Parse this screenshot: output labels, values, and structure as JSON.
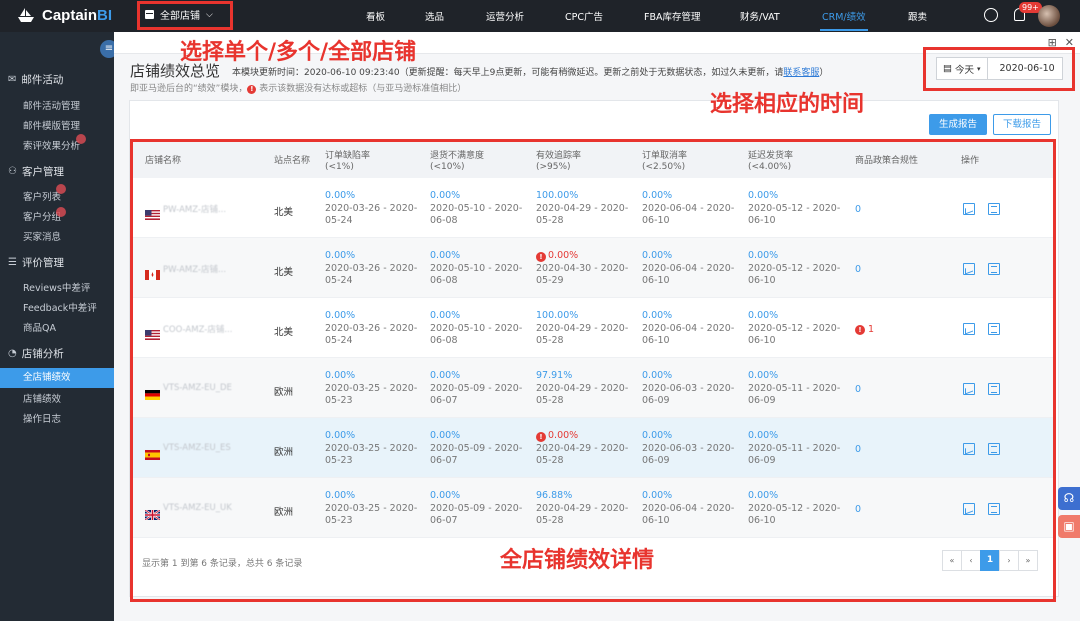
{
  "app": {
    "logo_a": "Captain",
    "logo_b": "BI",
    "shop_selector": "全部店铺"
  },
  "nav": [
    {
      "label": "看板"
    },
    {
      "label": "选品"
    },
    {
      "label": "运营分析"
    },
    {
      "label": "CPC广告"
    },
    {
      "label": "FBA库存管理"
    },
    {
      "label": "财务/VAT"
    },
    {
      "label": "CRM/绩效"
    },
    {
      "label": "跟卖"
    }
  ],
  "notif_badge": "99+",
  "sidebar": {
    "sections": [
      {
        "label": "邮件活动",
        "items": [
          "邮件活动管理",
          "邮件模版管理",
          "索评效果分析"
        ]
      },
      {
        "label": "客户管理",
        "items": [
          "客户列表",
          "客户分组",
          "买家消息"
        ]
      },
      {
        "label": "评价管理",
        "items": [
          "Reviews中差评",
          "Feedback中差评",
          "商品QA"
        ]
      },
      {
        "label": "店铺分析",
        "items": [
          "全店铺绩效",
          "店铺绩效",
          "操作日志"
        ]
      }
    ]
  },
  "page": {
    "title": "店铺绩效总览",
    "info": "本模块更新时间：2020-06-10 09:23:40（更新提醒：每天早上9点更新，可能有稍微延迟。更新之前处于无数据状态，如过久未更新，请",
    "contact": "联系客服",
    "info_end": "）",
    "subnote_a": "即亚马逊后台的“绩效”模块，",
    "subnote_b": "表示该数据没有达标或超标（与亚马逊标准值相比）",
    "date_preset": "今天",
    "date_value": "2020-06-10",
    "btn_generate": "生成报告",
    "btn_download": "下载报告"
  },
  "table": {
    "headers": {
      "shop": "店铺名称",
      "site": "站点名称",
      "odr": "订单缺陷率",
      "odr_sub": "(<1%)",
      "rdr": "退货不满意度",
      "rdr_sub": "(<10%)",
      "vtr": "有效追踪率",
      "vtr_sub": "(>95%)",
      "cr": "订单取消率",
      "cr_sub": "(<2.50%)",
      "ldr": "延迟发货率",
      "ldr_sub": "(<4.00%)",
      "policy": "商品政策合规性",
      "action": "操作"
    },
    "rows": [
      {
        "flag": "us",
        "shop": "PW-AMZ-店铺...",
        "site": "北美",
        "odr": {
          "v": "0.00%",
          "d": "2020-03-26 - 2020-05-24",
          "bad": false
        },
        "rdr": {
          "v": "0.00%",
          "d": "2020-05-10 - 2020-06-08",
          "bad": false
        },
        "vtr": {
          "v": "100.00%",
          "d": "2020-04-29 - 2020-05-28",
          "bad": false
        },
        "cr": {
          "v": "0.00%",
          "d": "2020-06-04 - 2020-06-10",
          "bad": false
        },
        "ldr": {
          "v": "0.00%",
          "d": "2020-05-12 - 2020-06-10",
          "bad": false
        },
        "policy": "0",
        "policy_bad": false
      },
      {
        "flag": "ca",
        "shop": "PW-AMZ-店铺...",
        "site": "北美",
        "odr": {
          "v": "0.00%",
          "d": "2020-03-26 - 2020-05-24",
          "bad": false
        },
        "rdr": {
          "v": "0.00%",
          "d": "2020-05-10 - 2020-06-08",
          "bad": false
        },
        "vtr": {
          "v": "0.00%",
          "d": "2020-04-30 - 2020-05-29",
          "bad": true
        },
        "cr": {
          "v": "0.00%",
          "d": "2020-06-04 - 2020-06-10",
          "bad": false
        },
        "ldr": {
          "v": "0.00%",
          "d": "2020-05-12 - 2020-06-10",
          "bad": false
        },
        "policy": "0",
        "policy_bad": false
      },
      {
        "flag": "us",
        "shop": "COO-AMZ-店铺...",
        "site": "北美",
        "odr": {
          "v": "0.00%",
          "d": "2020-03-26 - 2020-05-24",
          "bad": false
        },
        "rdr": {
          "v": "0.00%",
          "d": "2020-05-10 - 2020-06-08",
          "bad": false
        },
        "vtr": {
          "v": "100.00%",
          "d": "2020-04-29 - 2020-05-28",
          "bad": false
        },
        "cr": {
          "v": "0.00%",
          "d": "2020-06-04 - 2020-06-10",
          "bad": false
        },
        "ldr": {
          "v": "0.00%",
          "d": "2020-05-12 - 2020-06-10",
          "bad": false
        },
        "policy": "1",
        "policy_bad": true
      },
      {
        "flag": "de",
        "shop": "VTS-AMZ-EU_DE",
        "site": "欧洲",
        "odr": {
          "v": "0.00%",
          "d": "2020-03-25 - 2020-05-23",
          "bad": false
        },
        "rdr": {
          "v": "0.00%",
          "d": "2020-05-09 - 2020-06-07",
          "bad": false
        },
        "vtr": {
          "v": "97.91%",
          "d": "2020-04-29 - 2020-05-28",
          "bad": false
        },
        "cr": {
          "v": "0.00%",
          "d": "2020-06-03 - 2020-06-09",
          "bad": false
        },
        "ldr": {
          "v": "0.00%",
          "d": "2020-05-11 - 2020-06-09",
          "bad": false
        },
        "policy": "0",
        "policy_bad": false
      },
      {
        "flag": "es",
        "shop": "VTS-AMZ-EU_ES",
        "site": "欧洲",
        "odr": {
          "v": "0.00%",
          "d": "2020-03-25 - 2020-05-23",
          "bad": false
        },
        "rdr": {
          "v": "0.00%",
          "d": "2020-05-09 - 2020-06-07",
          "bad": false
        },
        "vtr": {
          "v": "0.00%",
          "d": "2020-04-29 - 2020-05-28",
          "bad": true
        },
        "cr": {
          "v": "0.00%",
          "d": "2020-06-03 - 2020-06-09",
          "bad": false
        },
        "ldr": {
          "v": "0.00%",
          "d": "2020-05-11 - 2020-06-09",
          "bad": false
        },
        "policy": "0",
        "policy_bad": false
      },
      {
        "flag": "uk",
        "shop": "VTS-AMZ-EU_UK",
        "site": "欧洲",
        "odr": {
          "v": "0.00%",
          "d": "2020-03-25 - 2020-05-23",
          "bad": false
        },
        "rdr": {
          "v": "0.00%",
          "d": "2020-05-09 - 2020-06-07",
          "bad": false
        },
        "vtr": {
          "v": "96.88%",
          "d": "2020-04-29 - 2020-05-28",
          "bad": false
        },
        "cr": {
          "v": "0.00%",
          "d": "2020-06-04 - 2020-06-10",
          "bad": false
        },
        "ldr": {
          "v": "0.00%",
          "d": "2020-05-12 - 2020-06-10",
          "bad": false
        },
        "policy": "0",
        "policy_bad": false
      }
    ],
    "footer": "显示第 1 到第 6 条记录，总共 6 条记录",
    "pager": [
      "«",
      "‹",
      "1",
      "›",
      "»"
    ]
  },
  "annotations": {
    "shop": "选择单个/多个/全部店铺",
    "time": "选择相应的时间",
    "detail": "全店铺绩效详情"
  },
  "colors": {
    "accent": "#3d9be9",
    "alert": "#e43a35",
    "annotation": "#e8342e",
    "topbar": "#1f2329",
    "sidebar": "#232b34"
  }
}
